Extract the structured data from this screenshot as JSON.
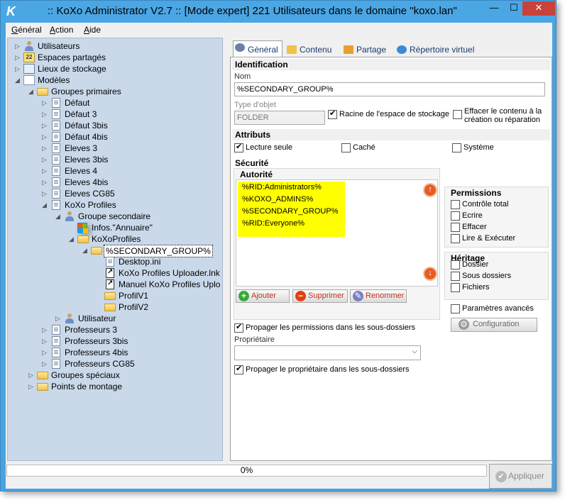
{
  "window": {
    "title": ":: KoXo Administrator V2.7 :: [Mode expert] 221 Utilisateurs dans le domaine \"koxo.lan\"",
    "app_icon": "K",
    "minimize": "—",
    "maximize": "☐",
    "close": "✕"
  },
  "menu": {
    "general": {
      "u": "G",
      "rest": "énéral"
    },
    "action": {
      "u": "A",
      "rest": "ction"
    },
    "aide": {
      "u": "A",
      "rest": "ide"
    }
  },
  "tree": [
    {
      "label": "Utilisateurs",
      "icon": "users-icon",
      "ic": "users",
      "exp": "▷"
    },
    {
      "label": "Espaces partagés",
      "icon": "share-icon",
      "ic": "share",
      "exp": "▷",
      "badge": "22"
    },
    {
      "label": "Lieux de stockage",
      "icon": "storage-icon",
      "ic": "store",
      "exp": "▷"
    },
    {
      "label": "Modèles",
      "icon": "models-icon",
      "ic": "models",
      "exp": "◢"
    },
    {
      "label": "Groupes primaires",
      "icon": "folder-icon",
      "ic": "folder",
      "exp": "◢"
    },
    {
      "label": "Défaut",
      "icon": "page-icon",
      "ic": "page",
      "exp": "▷"
    },
    {
      "label": "Défaut 3",
      "icon": "page-icon",
      "ic": "page",
      "exp": "▷"
    },
    {
      "label": "Défaut 3bis",
      "icon": "page-icon",
      "ic": "page",
      "exp": "▷"
    },
    {
      "label": "Défaut 4bis",
      "icon": "page-icon",
      "ic": "page",
      "exp": "▷"
    },
    {
      "label": "Eleves 3",
      "icon": "page-icon",
      "ic": "page",
      "exp": "▷"
    },
    {
      "label": "Eleves 3bis",
      "icon": "page-icon",
      "ic": "page",
      "exp": "▷"
    },
    {
      "label": "Eleves 4",
      "icon": "page-icon",
      "ic": "page",
      "exp": "▷"
    },
    {
      "label": "Eleves 4bis",
      "icon": "page-icon",
      "ic": "page",
      "exp": "▷"
    },
    {
      "label": "Eleves CG85",
      "icon": "page-icon",
      "ic": "page",
      "exp": "▷"
    },
    {
      "label": "KoXo Profiles",
      "icon": "page-icon",
      "ic": "page",
      "exp": "◢"
    },
    {
      "label": "Groupe secondaire",
      "icon": "group-icon",
      "ic": "users",
      "exp": "◢"
    },
    {
      "label": "Infos.\"Annuaire\"",
      "icon": "windows-icon",
      "ic": "win",
      "exp": ""
    },
    {
      "label": "KoXoProfiles",
      "icon": "folder-icon",
      "ic": "folder",
      "exp": "◢"
    },
    {
      "label": "%SECONDARY_GROUP%",
      "icon": "folder-icon",
      "ic": "folder",
      "exp": "◢",
      "selected": true
    },
    {
      "label": "Desktop.ini",
      "icon": "file-icon",
      "ic": "page",
      "exp": ""
    },
    {
      "label": "KoXo Profiles Uploader.lnk",
      "icon": "shortcut-icon",
      "ic": "shortcut",
      "exp": ""
    },
    {
      "label": "Manuel KoXo Profiles Uplo",
      "icon": "shortcut-icon",
      "ic": "shortcut",
      "exp": ""
    },
    {
      "label": "ProfilV1",
      "icon": "folder-icon",
      "ic": "folder",
      "exp": ""
    },
    {
      "label": "ProfilV2",
      "icon": "folder-icon",
      "ic": "folder",
      "exp": ""
    },
    {
      "label": "Utilisateur",
      "icon": "user-icon",
      "ic": "users",
      "exp": "▷"
    },
    {
      "label": "Professeurs 3",
      "icon": "page-icon",
      "ic": "page",
      "exp": "▷"
    },
    {
      "label": "Professeurs 3bis",
      "icon": "page-icon",
      "ic": "page",
      "exp": "▷"
    },
    {
      "label": "Professeurs 4bis",
      "icon": "page-icon",
      "ic": "page",
      "exp": "▷"
    },
    {
      "label": "Professeurs CG85",
      "icon": "page-icon",
      "ic": "page",
      "exp": "▷"
    },
    {
      "label": "Groupes spéciaux",
      "icon": "folder-icon",
      "ic": "folder",
      "exp": "▷"
    },
    {
      "label": "Points de montage",
      "icon": "folder-icon",
      "ic": "folder",
      "exp": "▷"
    }
  ],
  "tabs": [
    {
      "label": "Général",
      "icon": "gear-icon",
      "active": true
    },
    {
      "label": "Contenu",
      "icon": "folder-icon",
      "active": false
    },
    {
      "label": "Partage",
      "icon": "share-folder-icon",
      "active": false
    },
    {
      "label": "Répertoire virtuel",
      "icon": "globe-icon",
      "active": false
    }
  ],
  "identification": {
    "section": "Identification",
    "nom_label": "Nom",
    "nom_value": "%SECONDARY_GROUP%",
    "type_label": "Type d'objet",
    "type_value": "FOLDER",
    "racine_label": "Racine de l'espace de stockage",
    "racine_checked": true,
    "effacer_label_1": "Effacer le contenu à la",
    "effacer_label_2": "création ou réparation",
    "effacer_checked": false
  },
  "attributs": {
    "section": "Attributs",
    "lecture_seule": "Lecture seule",
    "lecture_checked": true,
    "cache": "Caché",
    "cache_checked": false,
    "systeme": "Système",
    "systeme_checked": false
  },
  "securite": {
    "section": "Sécurité",
    "autorite_label": "Autorité",
    "autorites": [
      "%RID:Administrators%",
      "%KOXO_ADMINS%",
      "%SECONDARY_GROUP%",
      "%RID:Everyone%"
    ],
    "highlight_color": "#ffff00",
    "up_arrow": "↑",
    "down_arrow": "↓",
    "ajouter": "Ajouter",
    "supprimer": "Supprimer",
    "renommer": "Renommer",
    "plus": "+",
    "minus": "−",
    "pencil": "✎"
  },
  "permissions": {
    "title": "Permissions",
    "items": [
      {
        "label": "Contrôle total",
        "checked": false
      },
      {
        "label": "Ecrire",
        "checked": false
      },
      {
        "label": "Effacer",
        "checked": false
      },
      {
        "label": "Lire & Exécuter",
        "checked": false
      }
    ]
  },
  "heritage": {
    "title": "Héritage",
    "items": [
      {
        "label": "Dossier",
        "checked": false
      },
      {
        "label": "Sous dossiers",
        "checked": false
      },
      {
        "label": "Fichiers",
        "checked": false
      }
    ]
  },
  "avance": {
    "label": "Paramètres avancés",
    "checked": false,
    "configuration": "Configuration"
  },
  "propagation": {
    "perms_label": "Propager les permissions dans les sous-dossiers",
    "perms_checked": true,
    "proprietaire_label": "Propriétaire",
    "proprietaire_value": "",
    "owner_label": "Propager le propriétaire dans les sous-dossiers",
    "owner_checked": true,
    "dropdown_arrow": "⌵"
  },
  "footer": {
    "progress": "0%",
    "progress_fraction": 0,
    "apply": "Appliquer",
    "check": "✔"
  }
}
